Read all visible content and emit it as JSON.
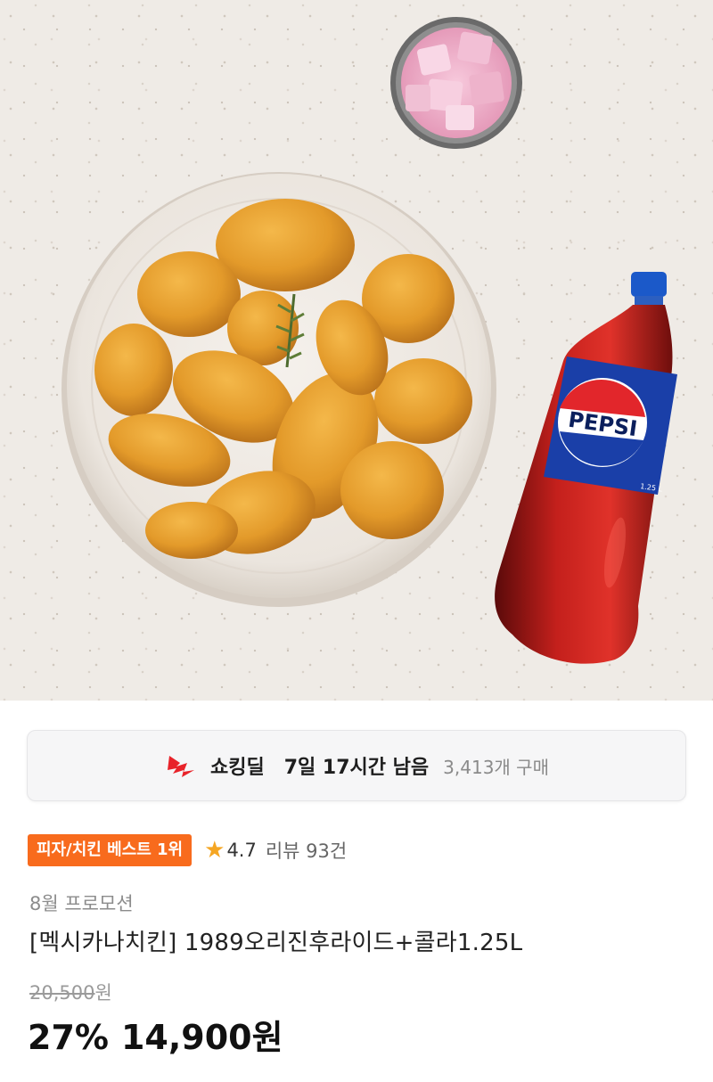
{
  "deal": {
    "icon": "lightning-bolt-icon",
    "name": "쇼킹딜",
    "time_left": "7일 17시간 남음",
    "purchase_count": "3,413개 구매"
  },
  "badges": {
    "rank_badge": "피자/치킨 베스트 1위",
    "rating_icon": "star-icon",
    "rating": "4.7",
    "reviews": "리뷰 93건"
  },
  "product": {
    "promo": "8월 프로모션",
    "title": "[멕시카나치킨] 1989오리진후라이드+콜라1.25L",
    "original_price": "20,500",
    "original_price_unit": "원",
    "discount": "27%",
    "price": "14,900원"
  },
  "hero": {
    "bottle_label": "PEPSI",
    "bottle_size": "1.25 L"
  },
  "colors": {
    "badge": "#f86b1d",
    "star": "#f5a623",
    "bolt": "#e8232a"
  }
}
